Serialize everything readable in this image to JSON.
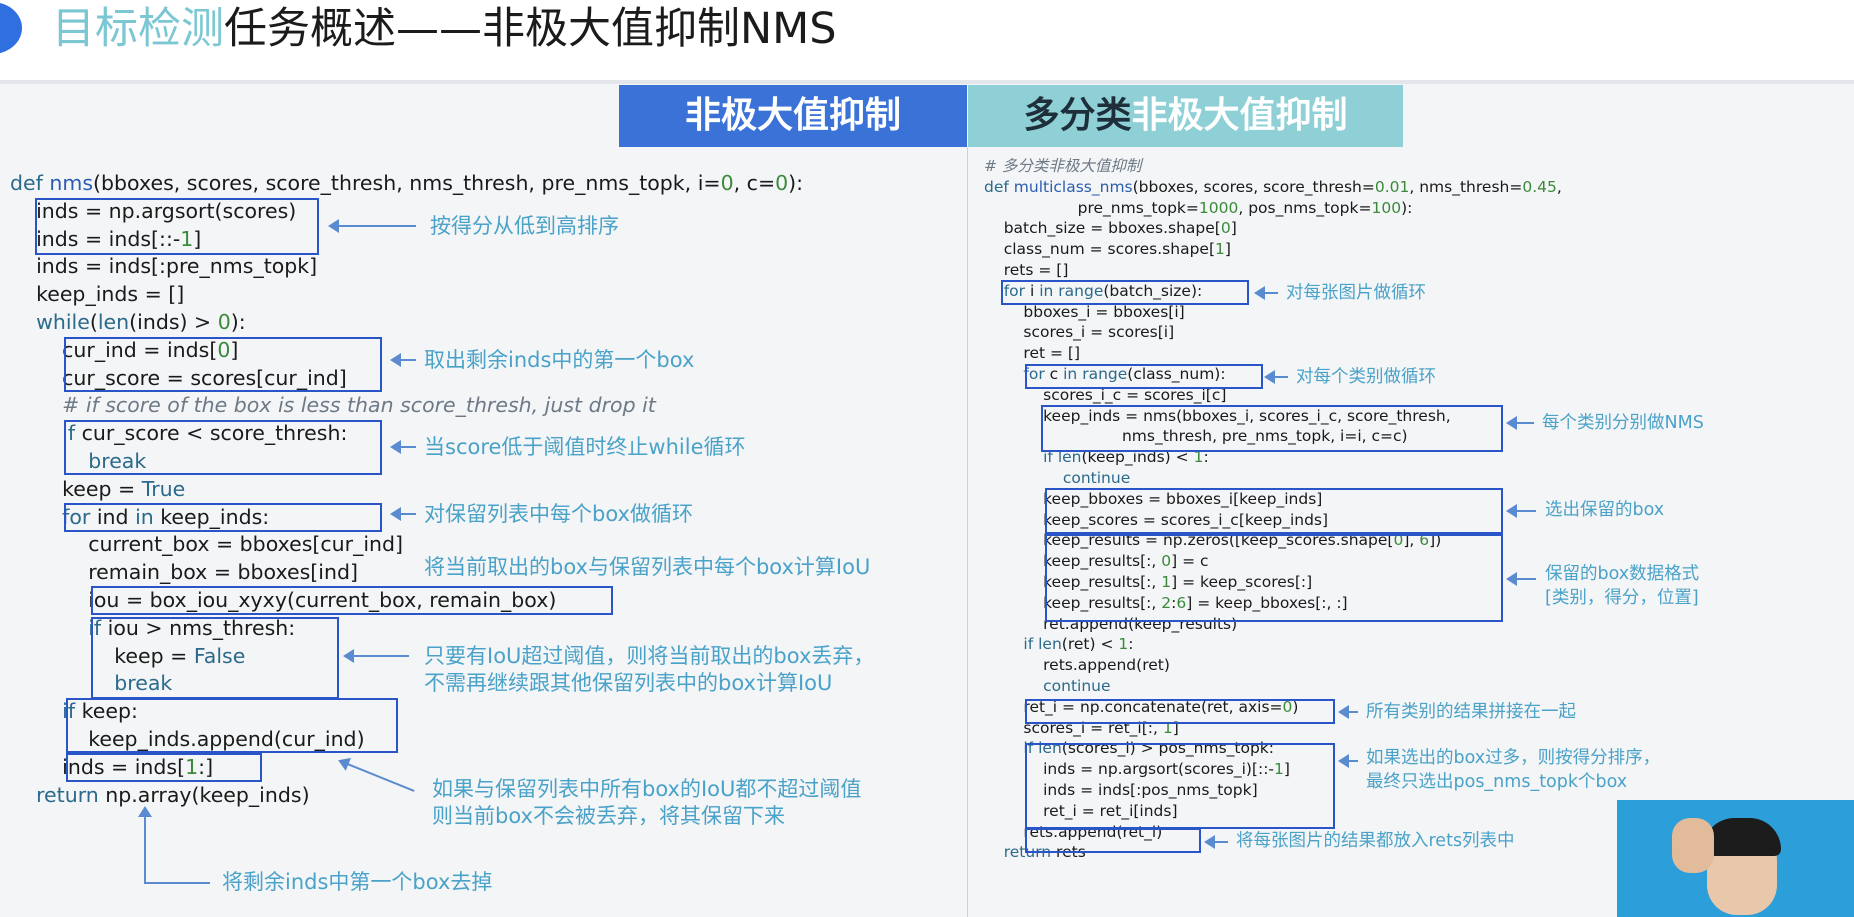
{
  "title": {
    "highlight": "目标检测",
    "rest": "任务概述——非极大值抑制NMS"
  },
  "banners": {
    "left": "非极大值抑制",
    "right_dark": "多分类",
    "right_rest": "非极大值抑制"
  },
  "left_notes": [
    "按得分从低到高排序",
    "取出剩余inds中的第一个box",
    "当score低于阈值时终止while循环",
    "对保留列表中每个box做循环",
    "将当前取出的box与保留列表中每个box计算IoU",
    "只要有IoU超过阈值，则将当前取出的box丢弃，\n不需再继续跟其他保留列表中的box计算IoU",
    "如果与保留列表中所有box的IoU都不超过阈值\n则当前box不会被丢弃，将其保留下来",
    "将剩余inds中第一个box去掉"
  ],
  "right_notes": [
    "对每张图片做循环",
    "对每个类别做循环",
    "每个类别分别做NMS",
    "选出保留的box",
    "保留的box数据格式\n[类别，得分，位置]",
    "所有类别的结果拼接在一起",
    "如果选出的box过多，则按得分排序，\n最终只选出pos_nms_topk个box",
    "将每张图片的结果都放入rets列表中"
  ],
  "colors": {
    "accent": "#3a72d8",
    "accent_light": "#8ed0d6",
    "box": "#2a55c8",
    "note": "#4aa2c8"
  }
}
